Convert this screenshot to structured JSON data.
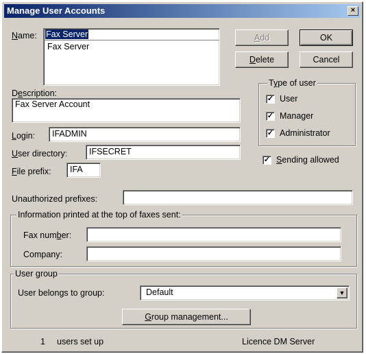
{
  "window": {
    "title": "Manage User Accounts",
    "close": "×"
  },
  "name": {
    "label_u": "N",
    "label_rest": "ame:",
    "value": "Fax Server",
    "list": [
      "Fax Server"
    ]
  },
  "buttons": {
    "add_u": "A",
    "add_rest": "dd",
    "ok": "OK",
    "delete_u": "D",
    "delete_rest": "elete",
    "cancel": "Cancel",
    "group_mgmt_u": "G",
    "group_mgmt_rest": "roup management..."
  },
  "description": {
    "label_pre": "D",
    "label_u": "e",
    "label_rest": "scription:",
    "value": "Fax Server Account"
  },
  "login": {
    "label_u": "L",
    "label_rest": "ogin:",
    "value": "IFADMIN"
  },
  "user_directory": {
    "label_u": "U",
    "label_rest": "ser directory:",
    "value": "IFSECRET"
  },
  "file_prefix": {
    "label_u": "F",
    "label_rest": "ile prefix:",
    "value": "IFA"
  },
  "type_of_user": {
    "title_pre": "T",
    "title_u": "y",
    "title_rest": "pe of user",
    "items": [
      {
        "label": "User",
        "checked": "✓"
      },
      {
        "label": "Manager",
        "checked": "✓"
      },
      {
        "label": "Administrator",
        "checked": "✓"
      }
    ]
  },
  "sending": {
    "label_u": "S",
    "label_rest": "ending allowed",
    "checked": "✓"
  },
  "unauthorized": {
    "label": "Unauthorized prefixes:",
    "value": ""
  },
  "info": {
    "title": "Information printed at the top of faxes sent:",
    "fax_label_pre": "Fax num",
    "fax_label_u": "b",
    "fax_label_rest": "er:",
    "fax_value": "",
    "company_label": "Company:",
    "company_value": ""
  },
  "user_group": {
    "title": "User group",
    "label": "User belongs to group:",
    "value": "Default",
    "arrow": "▼"
  },
  "status": {
    "count": "1",
    "count_label": "users set up",
    "licence": "Licence DM Server"
  }
}
